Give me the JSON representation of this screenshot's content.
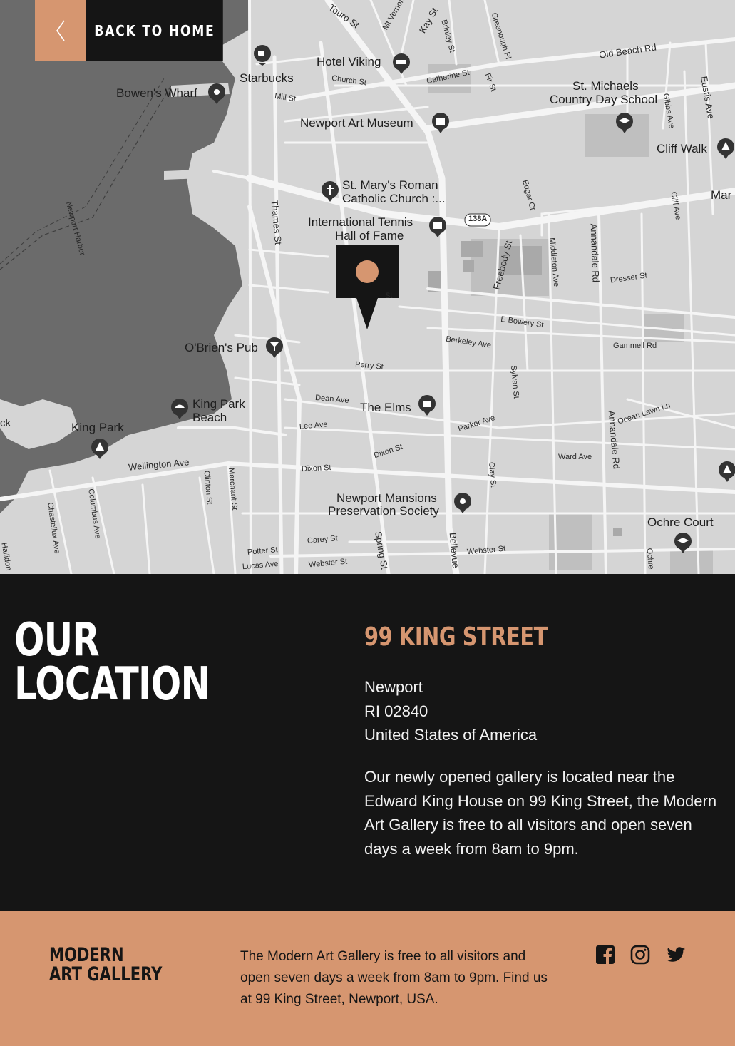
{
  "nav": {
    "back_label": "BACK TO HOME"
  },
  "map": {
    "pois": [
      "Hotel Viking",
      "Starbucks",
      "Bowen's Wharf",
      "St. Michaels",
      "Country Day School",
      "Newport Art Museum",
      "Cliff Walk",
      "St. Mary's Roman",
      "Catholic Church :...",
      "International Tennis",
      "Hall of Fame",
      "O'Brien's Pub",
      "King Park",
      "Beach",
      "King Park",
      "The Elms",
      "Newport Mansions",
      "Preservation Society",
      "Ochre Court",
      "Mar",
      "ck"
    ],
    "streets": [
      "Touro St",
      "Mt Vernon",
      "Kay St",
      "Brinley St",
      "Greenough Pl",
      "Old Beach Rd",
      "Church St",
      "Catherine St",
      "Fir St",
      "Mill St",
      "Gibbs Ave",
      "Eustis Ave",
      "Newport Harbor",
      "Thames St",
      "Edgar Ct",
      "138A",
      "Cliff Ave",
      "Freebody St",
      "Middleton Ave",
      "Annandale Rd",
      "Dresser St",
      "E Bowery St",
      "Berkeley Ave",
      "Gammell Rd",
      "Perry St",
      "Sylvan St",
      "Dean Ave",
      "Ocean Lawn Ln",
      "Lee Ave",
      "Parker Ave",
      "Dixon St",
      "Annandale Rd",
      "Ward Ave",
      "Wellington Ave",
      "Dixon St",
      "Clay St",
      "Clinton St",
      "Marchant St",
      "Columbus Ave",
      "Chastellux Ave",
      "Spring St",
      "Bellevue",
      "Carey St",
      "Webster St",
      "Potter St",
      "Webster St",
      "Lucas Ave",
      "Ochre",
      "Hallidon",
      "St"
    ]
  },
  "location": {
    "title_line1": "OUR",
    "title_line2": "LOCATION",
    "street": "99 KING STREET",
    "city": "Newport",
    "postcode": "RI 02840",
    "country": "United States of America",
    "description": "Our newly opened gallery is located near the Edward King House on 99 King Street, the Modern Art Gallery is free to all visitors and open seven days a week from 8am to 9pm."
  },
  "footer": {
    "logo_line1": "MODERN",
    "logo_line2": "ART GALLERY",
    "text": "The Modern Art Gallery is free to all visitors and open seven days a week from 8am to 9pm. Find us at 99 King Street, Newport, USA.",
    "social": [
      "facebook-icon",
      "instagram-icon",
      "twitter-icon"
    ]
  },
  "colors": {
    "accent": "#d69670",
    "dark": "#151515",
    "water": "#6f6f6f",
    "land": "#d4d4d4"
  }
}
